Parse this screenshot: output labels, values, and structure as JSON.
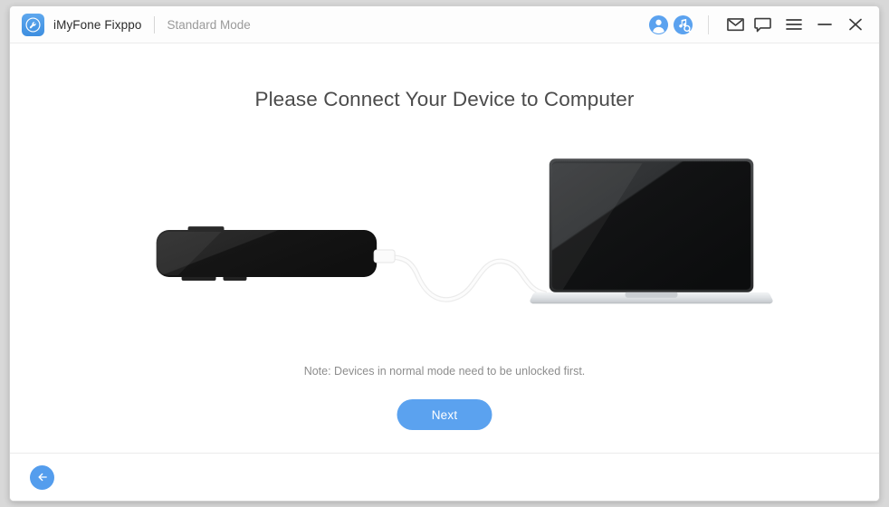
{
  "window": {
    "brand_name": "iMyFone Fixppo",
    "mode_label": "Standard Mode",
    "logo_icon": "wrench-circle-icon",
    "titlebar_icons": [
      {
        "name": "account-icon",
        "label": "Account"
      },
      {
        "name": "music-search-icon",
        "label": "Music Search"
      },
      {
        "name": "mail-icon",
        "label": "Mail"
      },
      {
        "name": "feedback-icon",
        "label": "Feedback"
      },
      {
        "name": "menu-icon",
        "label": "Menu"
      },
      {
        "name": "minimize-icon",
        "label": "Minimize"
      },
      {
        "name": "close-icon",
        "label": "Close"
      }
    ]
  },
  "main": {
    "title": "Please Connect Your Device to Computer",
    "note": "Note: Devices in normal mode need to be unlocked first.",
    "next_label": "Next",
    "illustration": {
      "phone": "black-phone-landscape",
      "laptop": "silver-laptop",
      "cable": "white-usb-cable"
    }
  },
  "footer": {
    "back_icon": "back-arrow-icon"
  },
  "colors": {
    "accent": "#5ba2ef",
    "accent_dark": "#3d8fe0",
    "title_text": "#4b4b4b",
    "note_text": "#8d8d8d",
    "mode_text": "#9a9a9a",
    "device_black": "#1d1d1d",
    "laptop_silver": "#d9dcdf",
    "window_bg": "#ffffff"
  }
}
